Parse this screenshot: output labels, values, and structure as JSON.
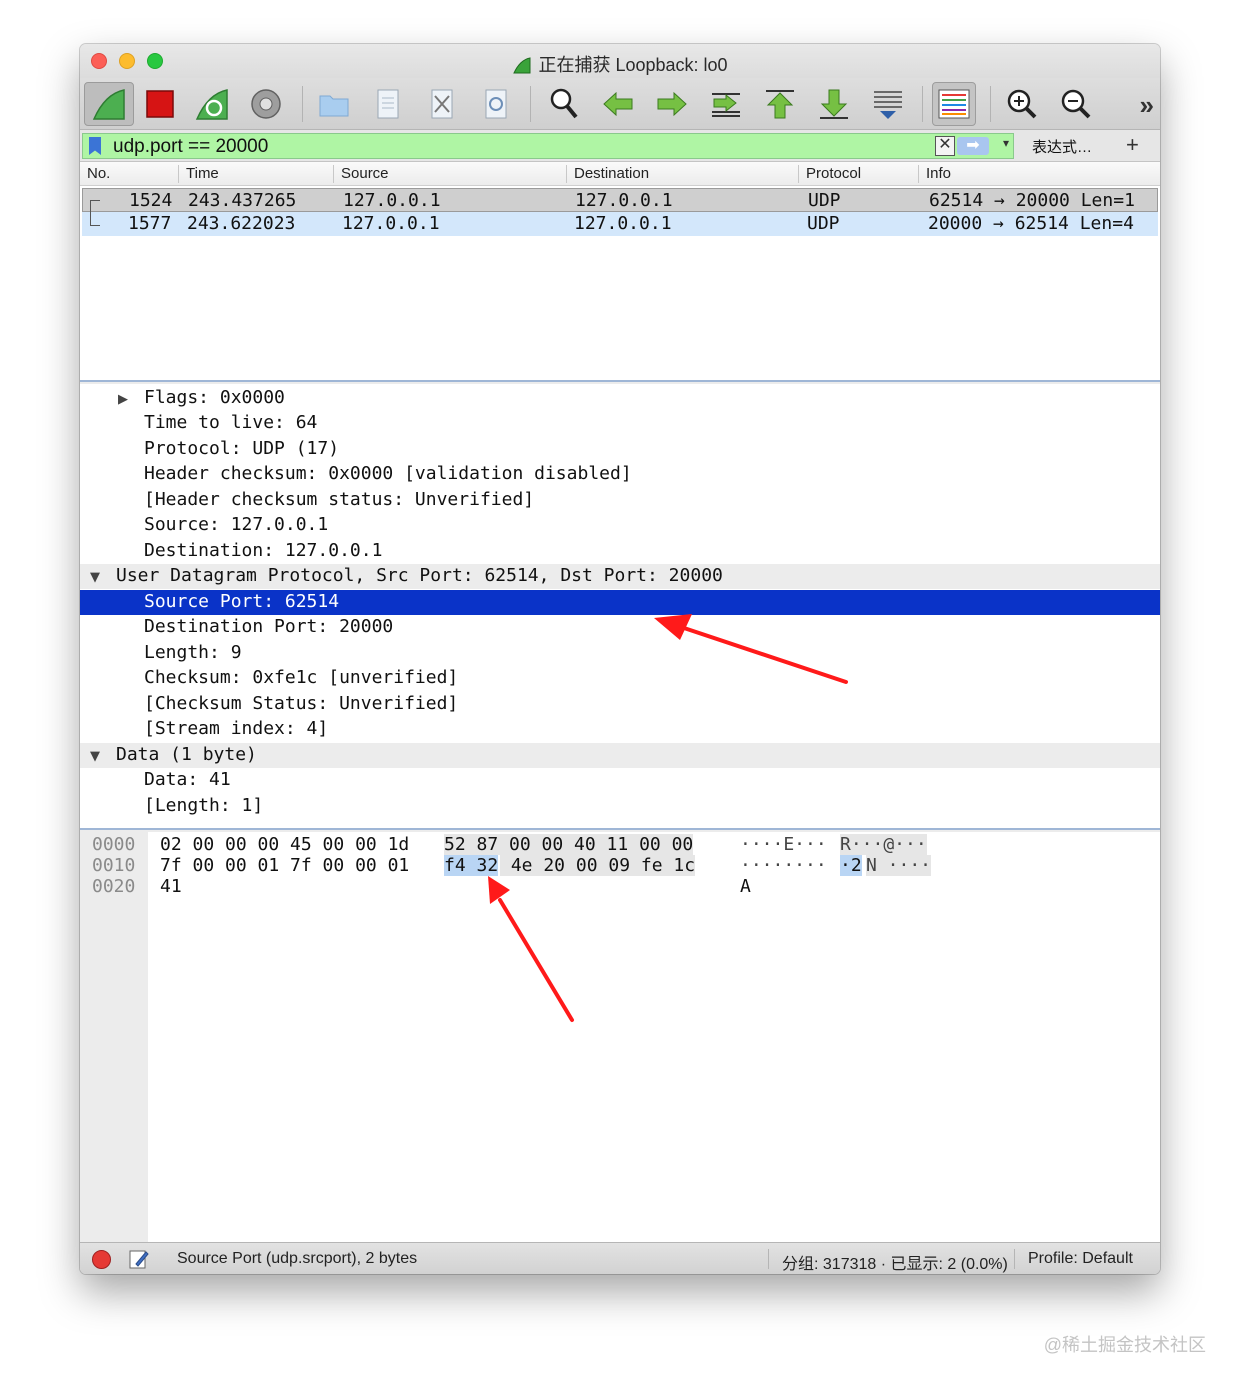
{
  "window": {
    "title": "正在捕获 Loopback: lo0"
  },
  "toolbar": {
    "icons": [
      "shark-fin-start-icon",
      "stop-capture-icon",
      "restart-capture-icon",
      "capture-options-icon",
      "open-file-icon",
      "save-file-icon",
      "close-file-icon",
      "reload-file-icon",
      "find-packet-icon",
      "go-back-icon",
      "go-forward-icon",
      "go-to-packet-icon",
      "go-first-icon",
      "go-last-icon",
      "autoscroll-icon",
      "colorize-icon",
      "zoom-in-icon",
      "zoom-out-icon",
      "more-icon"
    ],
    "more": "»"
  },
  "filter": {
    "value": "udp.port == 20000",
    "clear": "✕",
    "apply": "➡",
    "dropdown": "▾",
    "expression_label": "表达式…",
    "add_label": "+"
  },
  "packet_list": {
    "columns": [
      "No.",
      "Time",
      "Source",
      "Destination",
      "Protocol",
      "Info"
    ],
    "rows": [
      {
        "no": "1524",
        "time": "243.437265",
        "source": "127.0.0.1",
        "destination": "127.0.0.1",
        "protocol": "UDP",
        "info": "62514 → 20000 Len=1"
      },
      {
        "no": "1577",
        "time": "243.622023",
        "source": "127.0.0.1",
        "destination": "127.0.0.1",
        "protocol": "UDP",
        "info": "20000 → 62514 Len=4"
      }
    ]
  },
  "details": {
    "lines": [
      "Flags: 0x0000",
      "Time to live: 64",
      "Protocol: UDP (17)",
      "Header checksum: 0x0000 [validation disabled]",
      "[Header checksum status: Unverified]",
      "Source: 127.0.0.1",
      "Destination: 127.0.0.1",
      "User Datagram Protocol, Src Port: 62514, Dst Port: 20000",
      "Source Port: 62514",
      "Destination Port: 20000",
      "Length: 9",
      "Checksum: 0xfe1c [unverified]",
      "[Checksum Status: Unverified]",
      "[Stream index: 4]",
      "Data (1 byte)",
      "Data: 41",
      "[Length: 1]"
    ],
    "collapsed_marker": "▶",
    "expanded_marker": "▼"
  },
  "bytes": {
    "offsets": [
      "0000",
      "0010",
      "0020"
    ],
    "hex_rows": [
      {
        "a": "02 00 00 00 45 00 00 1d",
        "b": "52 87 00 00 40 11 00 00"
      },
      {
        "a": "7f 00 00 01 7f 00 00 01",
        "b_hl": "f4 32",
        "b_rest": " 4e 20 00 09 fe 1c"
      },
      {
        "a": "41",
        "b": ""
      }
    ],
    "ascii_rows": [
      {
        "a": "····E···",
        "b": "R···@···"
      },
      {
        "a": "········",
        "b_hl": "·2",
        "b_rest": "N ····"
      },
      {
        "a": "A",
        "b": ""
      }
    ]
  },
  "status": {
    "field_info": "Source Port (udp.srcport), 2 bytes",
    "packets": "分组: 317318 · 已显示: 2 (0.0%)",
    "profile": "Profile: Default"
  },
  "colors": {
    "selected_row": "#0a33c8",
    "filter_valid": "#aff5a4",
    "byte_highlight": "#b9d5f4",
    "arrow": "#ff1a1a"
  },
  "watermark": "@稀土掘金技术社区"
}
